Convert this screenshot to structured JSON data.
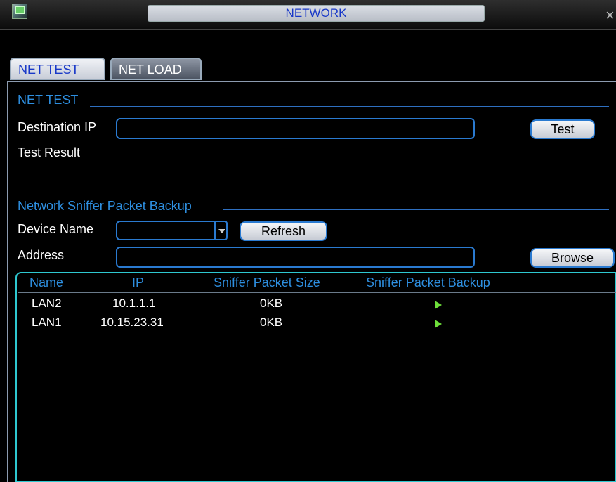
{
  "window": {
    "title": "NETWORK",
    "close_glyph": "×"
  },
  "tabs": [
    {
      "label": "NET TEST",
      "active": true
    },
    {
      "label": "NET LOAD",
      "active": false
    }
  ],
  "net_test": {
    "section_title": "NET TEST",
    "destination_ip_label": "Destination IP",
    "destination_ip_value": "",
    "test_button": "Test",
    "test_result_label": "Test Result",
    "test_result_value": ""
  },
  "sniffer": {
    "section_title": "Network Sniffer Packet Backup",
    "device_name_label": "Device Name",
    "device_name_value": "",
    "refresh_button": "Refresh",
    "address_label": "Address",
    "address_value": "",
    "browse_button": "Browse",
    "columns": [
      "Name",
      "IP",
      "Sniffer Packet Size",
      "Sniffer Packet Backup"
    ],
    "rows": [
      {
        "name": "LAN2",
        "ip": "10.1.1.1",
        "size": "0KB",
        "backup_icon": "play-icon"
      },
      {
        "name": "LAN1",
        "ip": "10.15.23.31",
        "size": "0KB",
        "backup_icon": "play-icon"
      }
    ]
  },
  "colors": {
    "accent_blue": "#2e8fe0",
    "border_blue": "#2a7ad0",
    "table_border": "#2ec8d0",
    "play_green": "#6ee03a"
  }
}
